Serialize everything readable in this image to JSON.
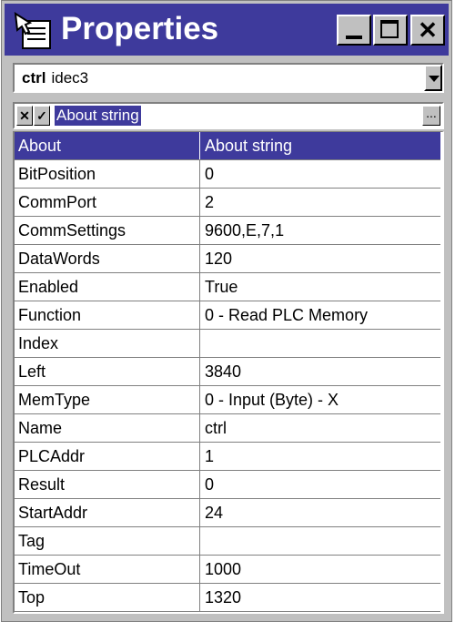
{
  "window": {
    "title": "Properties",
    "icon": "properties-icon",
    "accent": "#3e3a9c"
  },
  "object_selector": {
    "name": "ctrl",
    "type": "idec3"
  },
  "edit_bar": {
    "value": "About string",
    "ellipsis": "..."
  },
  "properties": [
    {
      "name": "About",
      "value": "About string",
      "selected": true
    },
    {
      "name": "BitPosition",
      "value": "0"
    },
    {
      "name": "CommPort",
      "value": "2"
    },
    {
      "name": "CommSettings",
      "value": "9600,E,7,1"
    },
    {
      "name": "DataWords",
      "value": "120"
    },
    {
      "name": "Enabled",
      "value": "True"
    },
    {
      "name": "Function",
      "value": "0 - Read PLC Memory"
    },
    {
      "name": "Index",
      "value": ""
    },
    {
      "name": "Left",
      "value": "3840"
    },
    {
      "name": "MemType",
      "value": "0 - Input (Byte) - X"
    },
    {
      "name": "Name",
      "value": "ctrl"
    },
    {
      "name": "PLCAddr",
      "value": "1"
    },
    {
      "name": "Result",
      "value": "0"
    },
    {
      "name": "StartAddr",
      "value": "24"
    },
    {
      "name": "Tag",
      "value": ""
    },
    {
      "name": "TimeOut",
      "value": "1000"
    },
    {
      "name": "Top",
      "value": "1320"
    }
  ]
}
